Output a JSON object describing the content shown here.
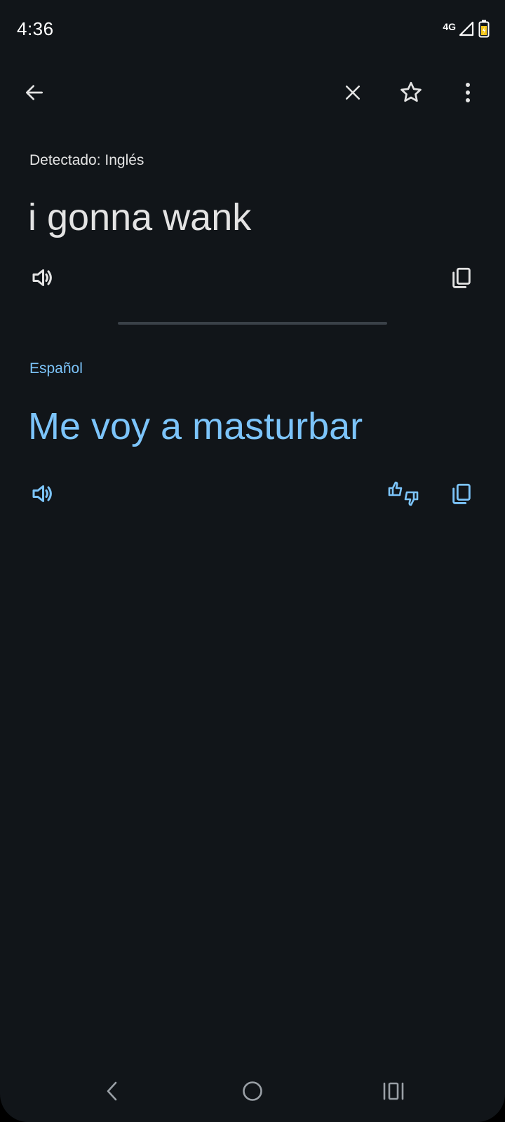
{
  "status_bar": {
    "time": "4:36",
    "network": "4G"
  },
  "toolbar": {
    "back_icon": "arrow-left-icon",
    "clear_icon": "close-icon",
    "favorite_icon": "star-outline-icon",
    "more_icon": "more-vert-icon"
  },
  "source": {
    "language_label": "Detectado: Inglés",
    "text": "i gonna wank",
    "speak_icon": "volume-up-icon",
    "copy_icon": "copy-icon"
  },
  "target": {
    "language_label": "Español",
    "text": "Me voy a masturbar",
    "speak_icon": "volume-up-icon",
    "feedback_icon": "thumbs-up-down-icon",
    "copy_icon": "copy-icon",
    "accent_color": "#7cc4fa"
  },
  "nav_bar": {
    "back_icon": "nav-back-icon",
    "home_icon": "nav-home-icon",
    "recents_icon": "nav-recents-icon"
  }
}
